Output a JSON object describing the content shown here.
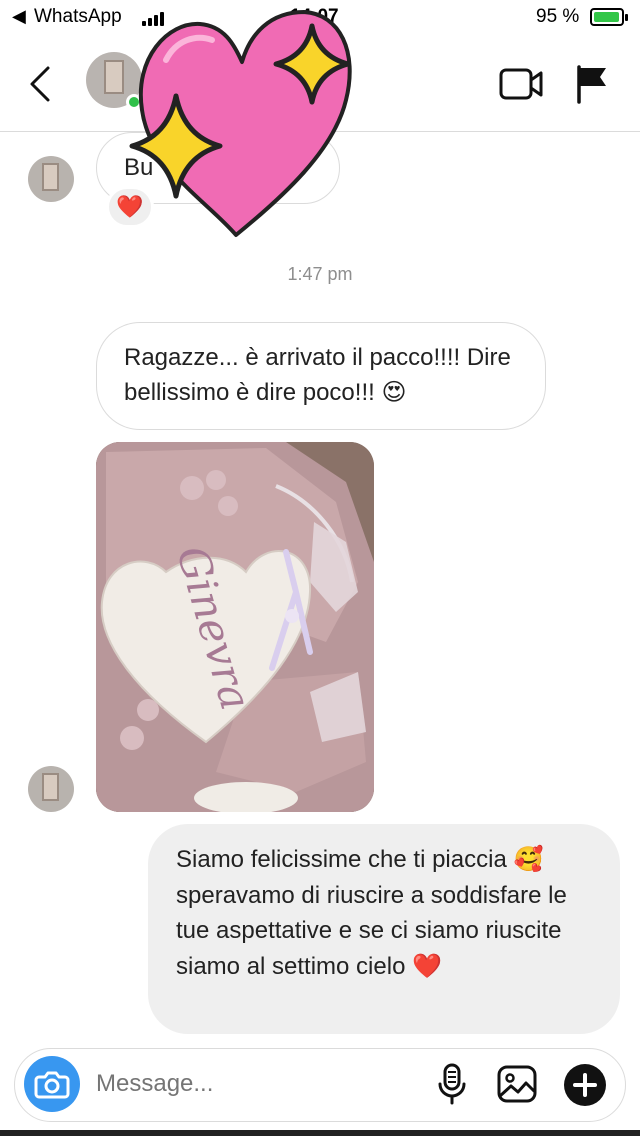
{
  "status_bar": {
    "back_app": "WhatsApp",
    "back_arrow": "◀",
    "time": "14:07",
    "battery_percent": "95 %",
    "battery_level": 0.95,
    "battery_icon": "battery-charging-icon",
    "signal_icon": "cellular-signal-icon"
  },
  "header": {
    "back_icon": "chevron-left-icon",
    "video_icon": "video-call-icon",
    "flag_icon": "flag-icon",
    "online": true,
    "online_color": "#30c04a"
  },
  "sticker": {
    "icon": "sparkling-heart-sticker",
    "heart_color": "#f06bb4",
    "star_color": "#f9d42a"
  },
  "messages": {
    "msg1": {
      "text": "Bu",
      "emoji": "😍",
      "reaction": "❤️"
    },
    "timestamp": "1:47 pm",
    "msg2": {
      "text": "Ragazze... è arrivato il pacco!!!! Dire bellissimo è dire poco!!! 😍"
    },
    "photo": {
      "embroidered_name": "Ginevra"
    },
    "msg3": {
      "text": "Siamo felicissime che ti piaccia 🥰 speravamo di riuscire a soddisfare le tue aspettative e se ci siamo riuscite siamo al settimo cielo ❤️"
    }
  },
  "composer": {
    "placeholder": "Message...",
    "camera_icon": "camera-icon",
    "mic_icon": "microphone-icon",
    "gallery_icon": "gallery-icon",
    "plus_icon": "plus-circle-icon",
    "accent_color": "#3897f0"
  }
}
